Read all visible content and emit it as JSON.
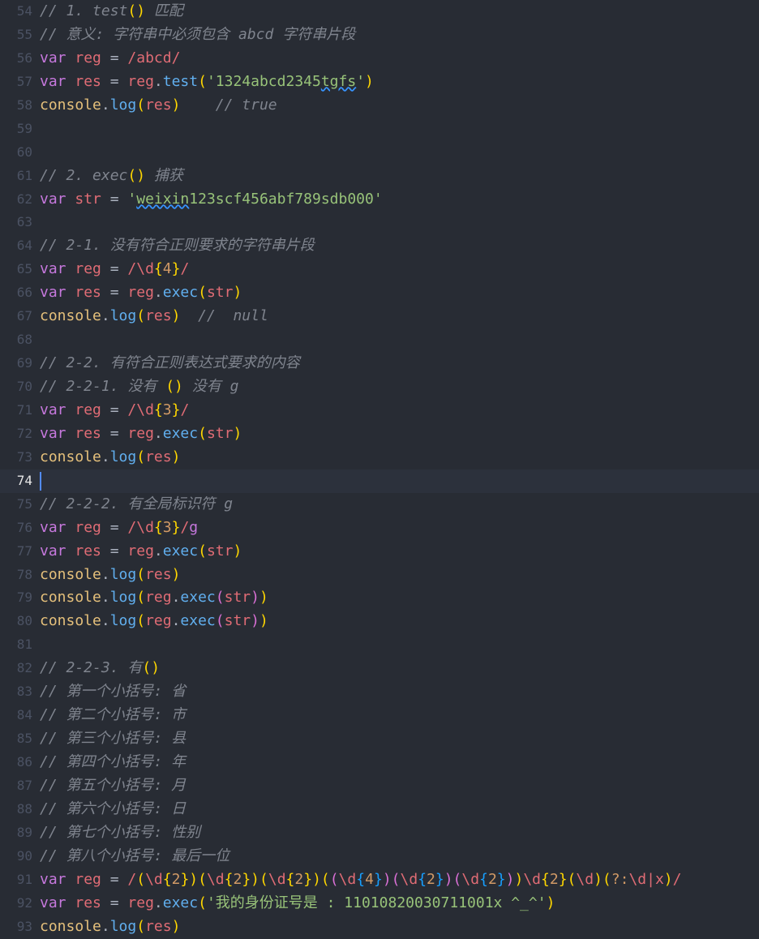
{
  "editor": {
    "current_line": 74,
    "lines": [
      {
        "n": 54,
        "t": [
          [
            "cm",
            "// 1. test"
          ],
          [
            "p1",
            "()"
          ],
          [
            "cm",
            " 匹配"
          ]
        ]
      },
      {
        "n": 55,
        "t": [
          [
            "cm",
            "// 意义: 字符串中必须包含 abcd 字符串片段"
          ]
        ]
      },
      {
        "n": 56,
        "t": [
          [
            "kw",
            "var"
          ],
          [
            "op",
            " "
          ],
          [
            "vr",
            "reg"
          ],
          [
            "op",
            " = "
          ],
          [
            "rx",
            "/abcd/"
          ]
        ]
      },
      {
        "n": 57,
        "t": [
          [
            "kw",
            "var"
          ],
          [
            "op",
            " "
          ],
          [
            "vr",
            "res"
          ],
          [
            "op",
            " = "
          ],
          [
            "vr",
            "reg"
          ],
          [
            "op",
            "."
          ],
          [
            "fn",
            "test"
          ],
          [
            "p1",
            "("
          ],
          [
            "st",
            "'1324abcd2345"
          ],
          [
            "st squig",
            "tgfs"
          ],
          [
            "st",
            "'"
          ],
          [
            "p1",
            ")"
          ]
        ]
      },
      {
        "n": 58,
        "t": [
          [
            "cl",
            "console"
          ],
          [
            "op",
            "."
          ],
          [
            "fn",
            "log"
          ],
          [
            "p1",
            "("
          ],
          [
            "vr",
            "res"
          ],
          [
            "p1",
            ")"
          ],
          [
            "op",
            "    "
          ],
          [
            "cm",
            "// true"
          ]
        ]
      },
      {
        "n": 59,
        "t": []
      },
      {
        "n": 60,
        "t": []
      },
      {
        "n": 61,
        "t": [
          [
            "cm",
            "// 2. exec"
          ],
          [
            "p1",
            "()"
          ],
          [
            "cm",
            " 捕获"
          ]
        ]
      },
      {
        "n": 62,
        "t": [
          [
            "kw",
            "var"
          ],
          [
            "op",
            " "
          ],
          [
            "vr",
            "str"
          ],
          [
            "op",
            " = "
          ],
          [
            "st",
            "'"
          ],
          [
            "st squig",
            "weixin"
          ],
          [
            "st",
            "123scf456abf789sdb000'"
          ]
        ]
      },
      {
        "n": 63,
        "t": []
      },
      {
        "n": 64,
        "t": [
          [
            "cm",
            "// 2-1. 没有符合正则要求的字符串片段"
          ]
        ]
      },
      {
        "n": 65,
        "t": [
          [
            "kw",
            "var"
          ],
          [
            "op",
            " "
          ],
          [
            "vr",
            "reg"
          ],
          [
            "op",
            " = "
          ],
          [
            "rx",
            "/\\d"
          ],
          [
            "p1",
            "{"
          ],
          [
            "rq",
            "4"
          ],
          [
            "p1",
            "}"
          ],
          [
            "rx",
            "/"
          ]
        ]
      },
      {
        "n": 66,
        "t": [
          [
            "kw",
            "var"
          ],
          [
            "op",
            " "
          ],
          [
            "vr",
            "res"
          ],
          [
            "op",
            " = "
          ],
          [
            "vr",
            "reg"
          ],
          [
            "op",
            "."
          ],
          [
            "fn",
            "exec"
          ],
          [
            "p1",
            "("
          ],
          [
            "vr",
            "str"
          ],
          [
            "p1",
            ")"
          ]
        ]
      },
      {
        "n": 67,
        "t": [
          [
            "cl",
            "console"
          ],
          [
            "op",
            "."
          ],
          [
            "fn",
            "log"
          ],
          [
            "p1",
            "("
          ],
          [
            "vr",
            "res"
          ],
          [
            "p1",
            ")"
          ],
          [
            "op",
            "  "
          ],
          [
            "cm",
            "//  null"
          ]
        ]
      },
      {
        "n": 68,
        "t": []
      },
      {
        "n": 69,
        "t": [
          [
            "cm",
            "// 2-2. 有符合正则表达式要求的内容"
          ]
        ]
      },
      {
        "n": 70,
        "t": [
          [
            "cm",
            "// 2-2-1. 没有 "
          ],
          [
            "p1",
            "()"
          ],
          [
            "cm",
            " 没有 g"
          ]
        ]
      },
      {
        "n": 71,
        "t": [
          [
            "kw",
            "var"
          ],
          [
            "op",
            " "
          ],
          [
            "vr",
            "reg"
          ],
          [
            "op",
            " = "
          ],
          [
            "rx",
            "/\\d"
          ],
          [
            "p1",
            "{"
          ],
          [
            "rq",
            "3"
          ],
          [
            "p1",
            "}"
          ],
          [
            "rx",
            "/"
          ]
        ]
      },
      {
        "n": 72,
        "t": [
          [
            "kw",
            "var"
          ],
          [
            "op",
            " "
          ],
          [
            "vr",
            "res"
          ],
          [
            "op",
            " = "
          ],
          [
            "vr",
            "reg"
          ],
          [
            "op",
            "."
          ],
          [
            "fn",
            "exec"
          ],
          [
            "p1",
            "("
          ],
          [
            "vr",
            "str"
          ],
          [
            "p1",
            ")"
          ]
        ]
      },
      {
        "n": 73,
        "t": [
          [
            "cl",
            "console"
          ],
          [
            "op",
            "."
          ],
          [
            "fn",
            "log"
          ],
          [
            "p1",
            "("
          ],
          [
            "vr",
            "res"
          ],
          [
            "p1",
            ")"
          ]
        ]
      },
      {
        "n": 74,
        "t": []
      },
      {
        "n": 75,
        "t": [
          [
            "cm",
            "// 2-2-2. 有全局标识符 g"
          ]
        ]
      },
      {
        "n": 76,
        "t": [
          [
            "kw",
            "var"
          ],
          [
            "op",
            " "
          ],
          [
            "vr",
            "reg"
          ],
          [
            "op",
            " = "
          ],
          [
            "rx",
            "/\\d"
          ],
          [
            "p1",
            "{"
          ],
          [
            "rq",
            "3"
          ],
          [
            "p1",
            "}"
          ],
          [
            "rx",
            "/"
          ],
          [
            "kw",
            "g"
          ]
        ]
      },
      {
        "n": 77,
        "t": [
          [
            "kw",
            "var"
          ],
          [
            "op",
            " "
          ],
          [
            "vr",
            "res"
          ],
          [
            "op",
            " = "
          ],
          [
            "vr",
            "reg"
          ],
          [
            "op",
            "."
          ],
          [
            "fn",
            "exec"
          ],
          [
            "p1",
            "("
          ],
          [
            "vr",
            "str"
          ],
          [
            "p1",
            ")"
          ]
        ]
      },
      {
        "n": 78,
        "t": [
          [
            "cl",
            "console"
          ],
          [
            "op",
            "."
          ],
          [
            "fn",
            "log"
          ],
          [
            "p1",
            "("
          ],
          [
            "vr",
            "res"
          ],
          [
            "p1",
            ")"
          ]
        ]
      },
      {
        "n": 79,
        "t": [
          [
            "cl",
            "console"
          ],
          [
            "op",
            "."
          ],
          [
            "fn",
            "log"
          ],
          [
            "p1",
            "("
          ],
          [
            "vr",
            "reg"
          ],
          [
            "op",
            "."
          ],
          [
            "fn",
            "exec"
          ],
          [
            "p2",
            "("
          ],
          [
            "vr",
            "str"
          ],
          [
            "p2",
            ")"
          ],
          [
            "p1",
            ")"
          ]
        ]
      },
      {
        "n": 80,
        "t": [
          [
            "cl",
            "console"
          ],
          [
            "op",
            "."
          ],
          [
            "fn",
            "log"
          ],
          [
            "p1",
            "("
          ],
          [
            "vr",
            "reg"
          ],
          [
            "op",
            "."
          ],
          [
            "fn",
            "exec"
          ],
          [
            "p2",
            "("
          ],
          [
            "vr",
            "str"
          ],
          [
            "p2",
            ")"
          ],
          [
            "p1",
            ")"
          ]
        ]
      },
      {
        "n": 81,
        "t": []
      },
      {
        "n": 82,
        "t": [
          [
            "cm",
            "// 2-2-3. 有"
          ],
          [
            "p1",
            "()"
          ]
        ]
      },
      {
        "n": 83,
        "t": [
          [
            "cm",
            "// 第一个小括号: 省"
          ]
        ]
      },
      {
        "n": 84,
        "t": [
          [
            "cm",
            "// 第二个小括号: 市"
          ]
        ]
      },
      {
        "n": 85,
        "t": [
          [
            "cm",
            "// 第三个小括号: 县"
          ]
        ]
      },
      {
        "n": 86,
        "t": [
          [
            "cm",
            "// 第四个小括号: 年"
          ]
        ]
      },
      {
        "n": 87,
        "t": [
          [
            "cm",
            "// 第五个小括号: 月"
          ]
        ]
      },
      {
        "n": 88,
        "t": [
          [
            "cm",
            "// 第六个小括号: 日"
          ]
        ]
      },
      {
        "n": 89,
        "t": [
          [
            "cm",
            "// 第七个小括号: 性别"
          ]
        ]
      },
      {
        "n": 90,
        "t": [
          [
            "cm",
            "// 第八个小括号: 最后一位"
          ]
        ]
      },
      {
        "n": 91,
        "t": [
          [
            "kw",
            "var"
          ],
          [
            "op",
            " "
          ],
          [
            "vr",
            "reg"
          ],
          [
            "op",
            " = "
          ],
          [
            "rx",
            "/"
          ],
          [
            "p1",
            "("
          ],
          [
            "rx",
            "\\d"
          ],
          [
            "p1",
            "{"
          ],
          [
            "rq",
            "2"
          ],
          [
            "p1",
            "})("
          ],
          [
            "rx",
            "\\d"
          ],
          [
            "p1",
            "{"
          ],
          [
            "rq",
            "2"
          ],
          [
            "p1",
            "})("
          ],
          [
            "rx",
            "\\d"
          ],
          [
            "p1",
            "{"
          ],
          [
            "rq",
            "2"
          ],
          [
            "p1",
            "})("
          ],
          [
            "p2",
            "("
          ],
          [
            "rx",
            "\\d"
          ],
          [
            "p3",
            "{"
          ],
          [
            "rq",
            "4"
          ],
          [
            "p3",
            "}"
          ],
          [
            "p2",
            ")("
          ],
          [
            "rx",
            "\\d"
          ],
          [
            "p3",
            "{"
          ],
          [
            "rq",
            "2"
          ],
          [
            "p3",
            "}"
          ],
          [
            "p2",
            ")("
          ],
          [
            "rx",
            "\\d"
          ],
          [
            "p3",
            "{"
          ],
          [
            "rq",
            "2"
          ],
          [
            "p3",
            "}"
          ],
          [
            "p2",
            ")"
          ],
          [
            "p1",
            ")"
          ],
          [
            "rx",
            "\\d"
          ],
          [
            "p1",
            "{"
          ],
          [
            "rq",
            "2"
          ],
          [
            "p1",
            "}("
          ],
          [
            "rx",
            "\\d"
          ],
          [
            "p1",
            ")("
          ],
          [
            "rq",
            "?:"
          ],
          [
            "rx",
            "\\d|x"
          ],
          [
            "p1",
            ")"
          ],
          [
            "rx",
            "/"
          ]
        ]
      },
      {
        "n": 92,
        "t": [
          [
            "kw",
            "var"
          ],
          [
            "op",
            " "
          ],
          [
            "vr",
            "res"
          ],
          [
            "op",
            " = "
          ],
          [
            "vr",
            "reg"
          ],
          [
            "op",
            "."
          ],
          [
            "fn",
            "exec"
          ],
          [
            "p1",
            "("
          ],
          [
            "st",
            "'我的身份证号是 : 11010820030711001x ^_^'"
          ],
          [
            "p1",
            ")"
          ]
        ]
      },
      {
        "n": 93,
        "t": [
          [
            "cl",
            "console"
          ],
          [
            "op",
            "."
          ],
          [
            "fn",
            "log"
          ],
          [
            "p1",
            "("
          ],
          [
            "vr",
            "res"
          ],
          [
            "p1",
            ")"
          ]
        ]
      }
    ]
  }
}
